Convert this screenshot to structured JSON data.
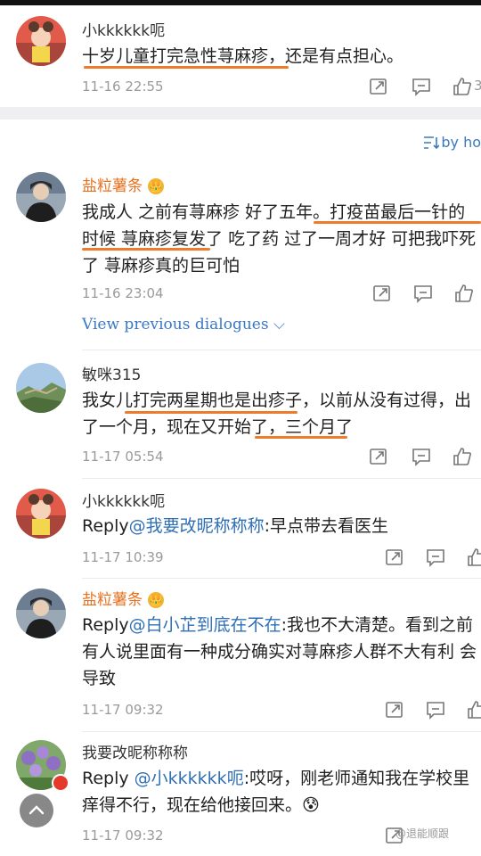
{
  "sort_label": "by ho",
  "view_previous": "View previous dialogues ⌵",
  "watermark": "@退能顺跟",
  "comments": [
    {
      "name": "小kkkkkk呃",
      "text": "十岁儿童打完急性荨麻疹，还是有点担心。",
      "time": "11-16 22:55",
      "like_count": "3"
    },
    {
      "name": "盐粒薯条",
      "badge": "👑",
      "text": "我成人 之前有荨麻疹 好了五年。打疫苗最后一针的时候 荨麻疹复发了 吃了药 过了一周才好 可把我吓死了 荨麻疹真的巨可怕",
      "time": "11-16 23:04"
    },
    {
      "name": "敏咪315",
      "text": "我女儿打完两星期也是出疹子，以前从没有过得，出了一个月，现在又开始了，三个月了",
      "time": "11-17 05:54"
    },
    {
      "name": "小kkkkkk呃",
      "reply_prefix": "Reply",
      "mention": "@我要改昵称称称",
      "text": ":早点带去看医生",
      "time": "11-17 10:39"
    },
    {
      "name": "盐粒薯条",
      "badge": "👑",
      "reply_prefix": "Reply",
      "mention": "@白小芷到底在不在",
      "text": ":我也不大清楚。看到之前有人说里面有一种成分确实对荨麻疹人群不大有利 会导致",
      "time": "11-17 09:32"
    },
    {
      "name": "我要改昵称称称",
      "reply_prefix": "Reply ",
      "mention": "@小kkkkkk呃",
      "text": ":哎呀，刚老师通知我在学校里痒得不行，现在给他接回来。😰",
      "time": "11-17 09:32"
    }
  ],
  "colors": {
    "accent_orange": "#ee7a2b",
    "link_blue": "#3a78c3",
    "username_orange": "#e8711e"
  },
  "icons": [
    "share-icon",
    "comment-icon",
    "like-icon",
    "sort-icon",
    "chevron-down-icon",
    "vip-crown-icon",
    "back-to-top-icon"
  ]
}
